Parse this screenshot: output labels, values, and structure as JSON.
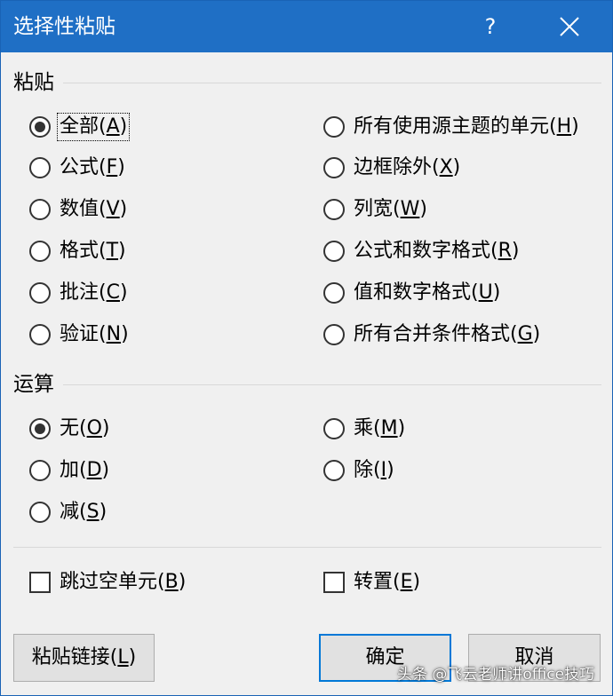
{
  "window": {
    "title": "选择性粘贴",
    "help_label": "?"
  },
  "paste": {
    "heading": "粘贴",
    "left": [
      {
        "text": "全部(",
        "key": "A",
        "end": ")"
      },
      {
        "text": "公式(",
        "key": "F",
        "end": ")"
      },
      {
        "text": "数值(",
        "key": "V",
        "end": ")"
      },
      {
        "text": "格式(",
        "key": "T",
        "end": ")"
      },
      {
        "text": "批注(",
        "key": "C",
        "end": ")"
      },
      {
        "text": "验证(",
        "key": "N",
        "end": ")"
      }
    ],
    "right": [
      {
        "text": "所有使用源主题的单元(",
        "key": "H",
        "end": ")"
      },
      {
        "text": "边框除外(",
        "key": "X",
        "end": ")"
      },
      {
        "text": "列宽(",
        "key": "W",
        "end": ")"
      },
      {
        "text": "公式和数字格式(",
        "key": "R",
        "end": ")"
      },
      {
        "text": "值和数字格式(",
        "key": "U",
        "end": ")"
      },
      {
        "text": "所有合并条件格式(",
        "key": "G",
        "end": ")"
      }
    ]
  },
  "operation": {
    "heading": "运算",
    "left": [
      {
        "text": "无(",
        "key": "O",
        "end": ")"
      },
      {
        "text": "加(",
        "key": "D",
        "end": ")"
      },
      {
        "text": "减(",
        "key": "S",
        "end": ")"
      }
    ],
    "right": [
      {
        "text": "乘(",
        "key": "M",
        "end": ")"
      },
      {
        "text": "除(",
        "key": "I",
        "end": ")"
      }
    ]
  },
  "checkboxes": {
    "skip_blanks": {
      "text": "跳过空单元(",
      "key": "B",
      "end": ")"
    },
    "transpose": {
      "text": "转置(",
      "key": "E",
      "end": ")"
    }
  },
  "buttons": {
    "paste_link": {
      "text": "粘贴链接(",
      "key": "L",
      "end": ")"
    },
    "ok": "确定",
    "cancel": "取消"
  },
  "watermark": "头条 @飞云老师讲office技巧",
  "colors": {
    "titlebar": "#1f6fc5",
    "default_button_border": "#0078d7"
  }
}
